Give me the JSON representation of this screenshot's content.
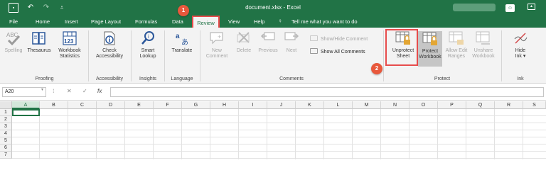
{
  "window": {
    "title": "document.xlsx - Excel"
  },
  "quick_access": {
    "save_icon": "save-icon",
    "undo_icon": "undo-icon",
    "redo_icon": "redo-icon",
    "customize_icon": "customize-icon"
  },
  "tabs": [
    "File",
    "Home",
    "Insert",
    "Page Layout",
    "Formulas",
    "Data",
    "Review",
    "View",
    "Help"
  ],
  "active_tab": "Review",
  "tell_me": "Tell me what you want to do",
  "badges": {
    "step1": "1",
    "step2": "2"
  },
  "ribbon": {
    "proofing": {
      "label": "Proofing",
      "spelling": "Spelling",
      "thesaurus": "Thesaurus",
      "stats_1": "Workbook",
      "stats_2": "Statistics"
    },
    "accessibility": {
      "label": "Accessibility",
      "check_1": "Check",
      "check_2": "Accessibility"
    },
    "insights": {
      "label": "Insights",
      "smart_1": "Smart",
      "smart_2": "Lookup"
    },
    "language": {
      "label": "Language",
      "translate": "Translate"
    },
    "comments": {
      "label": "Comments",
      "new_1": "New",
      "new_2": "Comment",
      "delete": "Delete",
      "previous": "Previous",
      "next": "Next",
      "show_hide": "Show/Hide Comment",
      "show_all": "Show All Comments"
    },
    "protect": {
      "label": "Protect",
      "unprotect_1": "Unprotect",
      "unprotect_2": "Sheet",
      "protect_wb_1": "Protect",
      "protect_wb_2": "Workbook",
      "allow_1": "Allow Edit",
      "allow_2": "Ranges",
      "unshare_1": "Unshare",
      "unshare_2": "Workbook"
    },
    "ink": {
      "label": "Ink",
      "hide_1": "Hide",
      "hide_2": "Ink"
    }
  },
  "formula_bar": {
    "name_box": "A20",
    "fx": "fx",
    "value": ""
  },
  "columns": [
    "A",
    "B",
    "C",
    "D",
    "E",
    "F",
    "G",
    "H",
    "I",
    "J",
    "K",
    "L",
    "M",
    "N",
    "O",
    "P",
    "Q",
    "R",
    "S"
  ],
  "rows": [
    "1",
    "2",
    "3",
    "4",
    "5",
    "6",
    "7"
  ],
  "selected_cell": "A20",
  "colors": {
    "excel_green": "#217346",
    "highlight_red": "#e74c4c",
    "badge_orange": "#e8583c"
  }
}
